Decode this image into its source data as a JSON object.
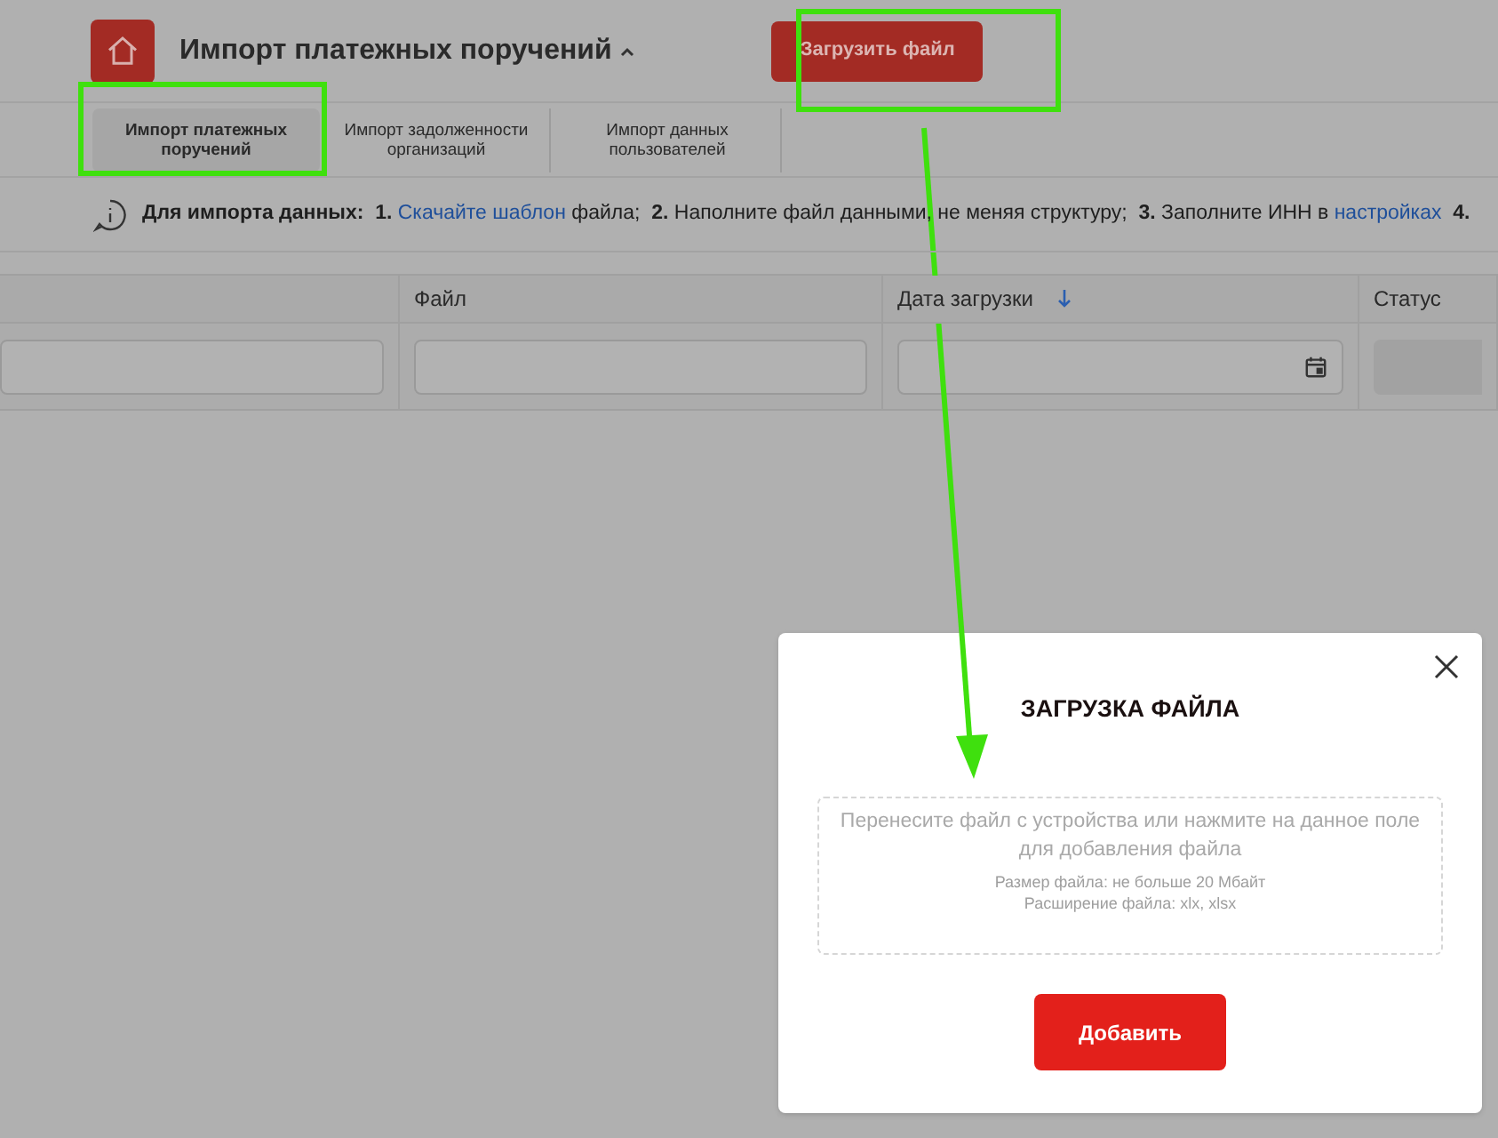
{
  "header": {
    "title": "Импорт платежных поручений",
    "upload_button": "Загрузить файл"
  },
  "tabs": [
    {
      "label": "Импорт платежных поручений",
      "selected": true
    },
    {
      "label": "Импорт задолженности организаций",
      "selected": false
    },
    {
      "label": "Импорт данных пользователей",
      "selected": false
    }
  ],
  "info": [
    {
      "kind": "text",
      "text": "**Для импорта данных:**  **1.** "
    },
    {
      "kind": "link",
      "text": "Скачайте шаблон"
    },
    {
      "kind": "text",
      "text": " файла;  **2.** Наполните файл данными, не меняя структуру;  **3.** Заполните ИНН в "
    },
    {
      "kind": "link",
      "text": "настройках"
    },
    {
      "kind": "text",
      "text": "  **4.**"
    }
  ],
  "table": {
    "columns": [
      {
        "kind": "text"
      },
      {
        "label": "Файл",
        "kind": "text"
      },
      {
        "label": "Дата загрузки",
        "kind": "date",
        "sorted": true
      },
      {
        "label": "Статус",
        "kind": "select"
      }
    ]
  },
  "modal": {
    "title": "ЗАГРУЗКА ФАЙЛА",
    "drop_text": "Перенесите файл с устройства или нажмите на данное поле для добавления файла",
    "hints": [
      "Размер файла: не больше 20 Мбайт",
      "Расширение файла: xlx, xlsx"
    ],
    "button": "Добавить"
  }
}
